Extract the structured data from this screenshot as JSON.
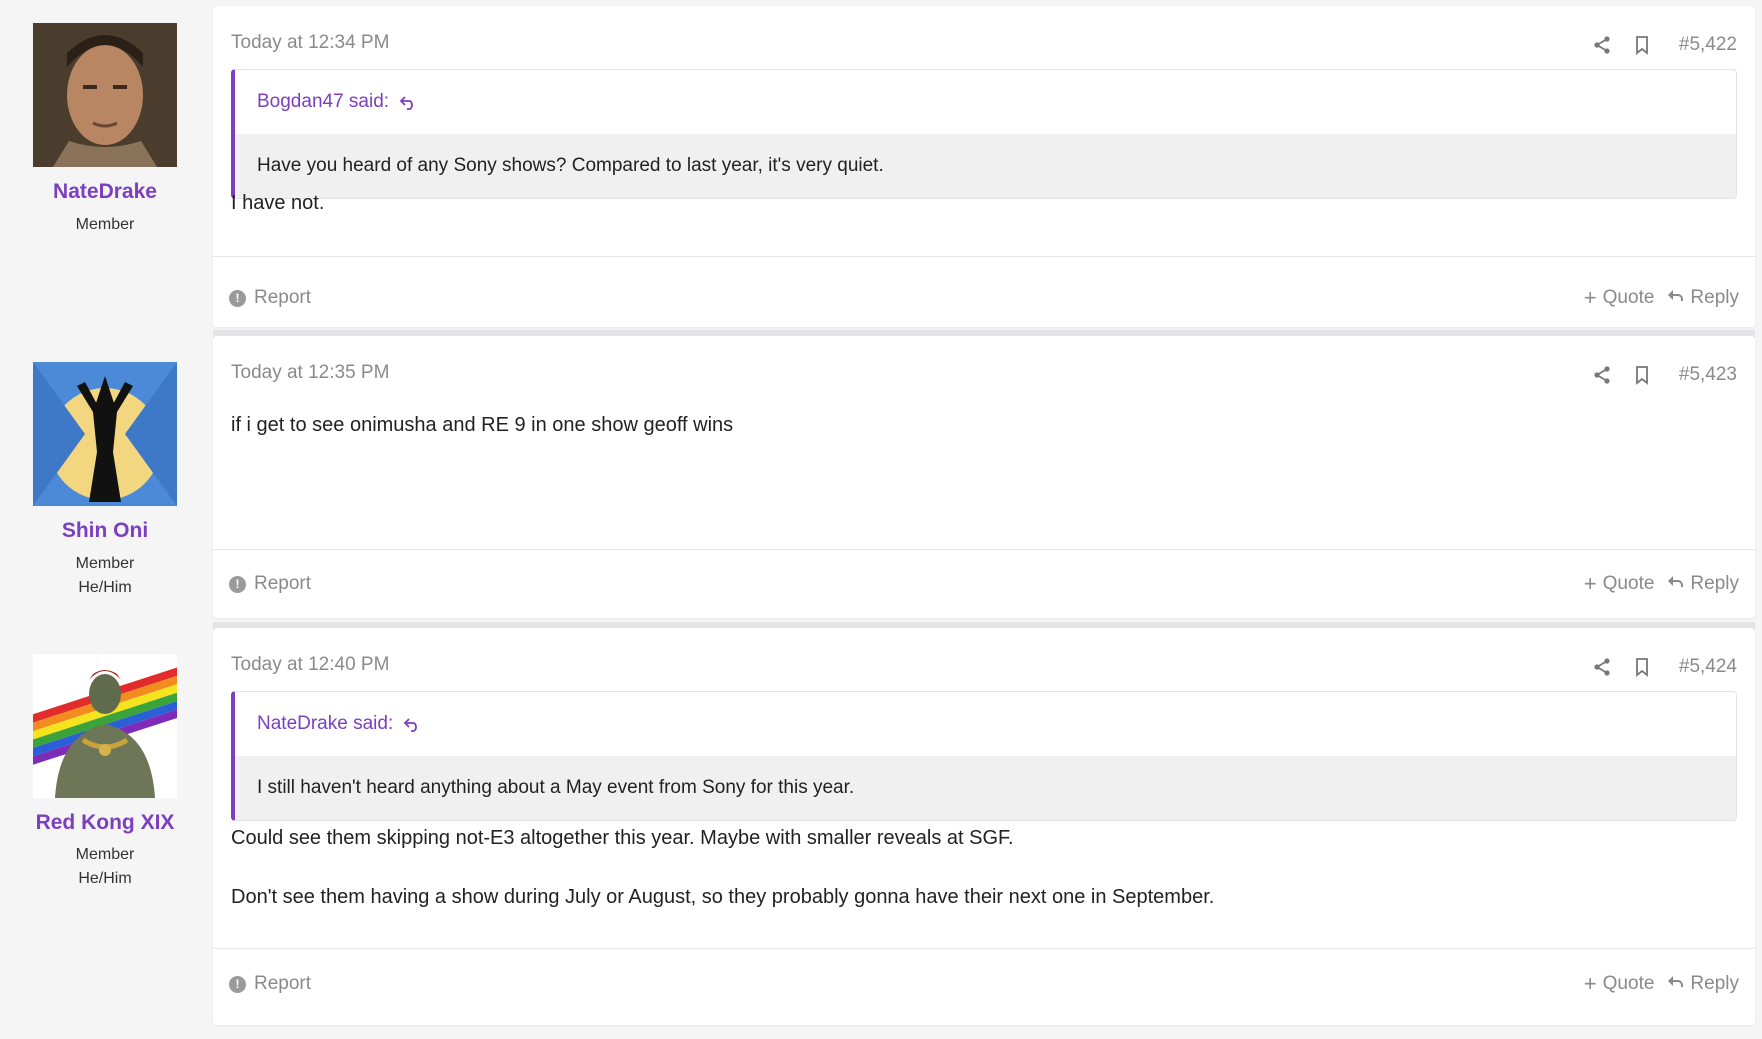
{
  "posts": [
    {
      "user": {
        "name": "NateDrake",
        "title": "Member",
        "pronouns": ""
      },
      "date": "Today at 12:34 PM",
      "number": "#5,422",
      "quote": {
        "author": "Bogdan47 said:",
        "text": "Have you heard of any Sony shows? Compared to last year, it's very quiet."
      },
      "message": [
        "I have not."
      ],
      "report_label": "Report",
      "quote_label": "Quote",
      "reply_label": "Reply"
    },
    {
      "user": {
        "name": "Shin Oni",
        "title": "Member",
        "pronouns": "He/Him"
      },
      "date": "Today at 12:35 PM",
      "number": "#5,423",
      "message": [
        "if i get to see onimusha and RE 9 in one show geoff wins"
      ],
      "report_label": "Report",
      "quote_label": "Quote",
      "reply_label": "Reply"
    },
    {
      "user": {
        "name": "Red Kong XIX",
        "title": "Member",
        "pronouns": "He/Him"
      },
      "date": "Today at 12:40 PM",
      "number": "#5,424",
      "quote": {
        "author": "NateDrake said:",
        "text": "I still haven't heard anything about a May event from Sony for this year."
      },
      "message": [
        "Could see them skipping not-E3 altogether this year. Maybe with smaller reveals at SGF.",
        "Don't see them having a show during July or August, so they probably gonna have their next one in September."
      ],
      "report_label": "Report",
      "quote_label": "Quote",
      "reply_label": "Reply"
    }
  ],
  "icons": {
    "share": "share-icon",
    "bookmark": "bookmark-icon",
    "quote_jump": "quote-jump-icon",
    "report": "report-icon",
    "reply": "reply-icon"
  },
  "colors": {
    "accent": "#7b3fc0",
    "muted": "#8a8a8a",
    "quote_bg": "#f0f0f1"
  }
}
